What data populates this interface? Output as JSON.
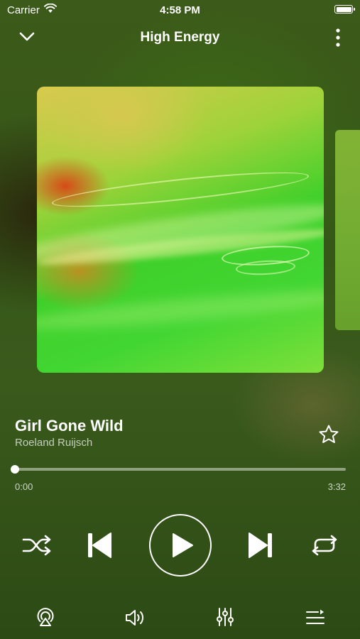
{
  "status_bar": {
    "carrier": "Carrier",
    "time": "4:58 PM"
  },
  "header": {
    "title": "High Energy"
  },
  "track": {
    "title": "Girl Gone Wild",
    "artist": "Roeland Ruijsch",
    "elapsed": "0:00",
    "duration": "3:32",
    "progress_fraction": 0.0,
    "favorited": false
  },
  "icons": {
    "collapse": "chevron-down-icon",
    "more": "more-vertical-icon",
    "favorite": "star-icon",
    "shuffle": "shuffle-icon",
    "previous": "skip-previous-icon",
    "play": "play-icon",
    "next": "skip-next-icon",
    "repeat": "repeat-icon",
    "airplay": "airplay-icon",
    "volume": "volume-icon",
    "equalizer": "equalizer-icon",
    "queue": "queue-icon"
  },
  "colors": {
    "foreground": "#ffffff",
    "background": "#355818"
  }
}
